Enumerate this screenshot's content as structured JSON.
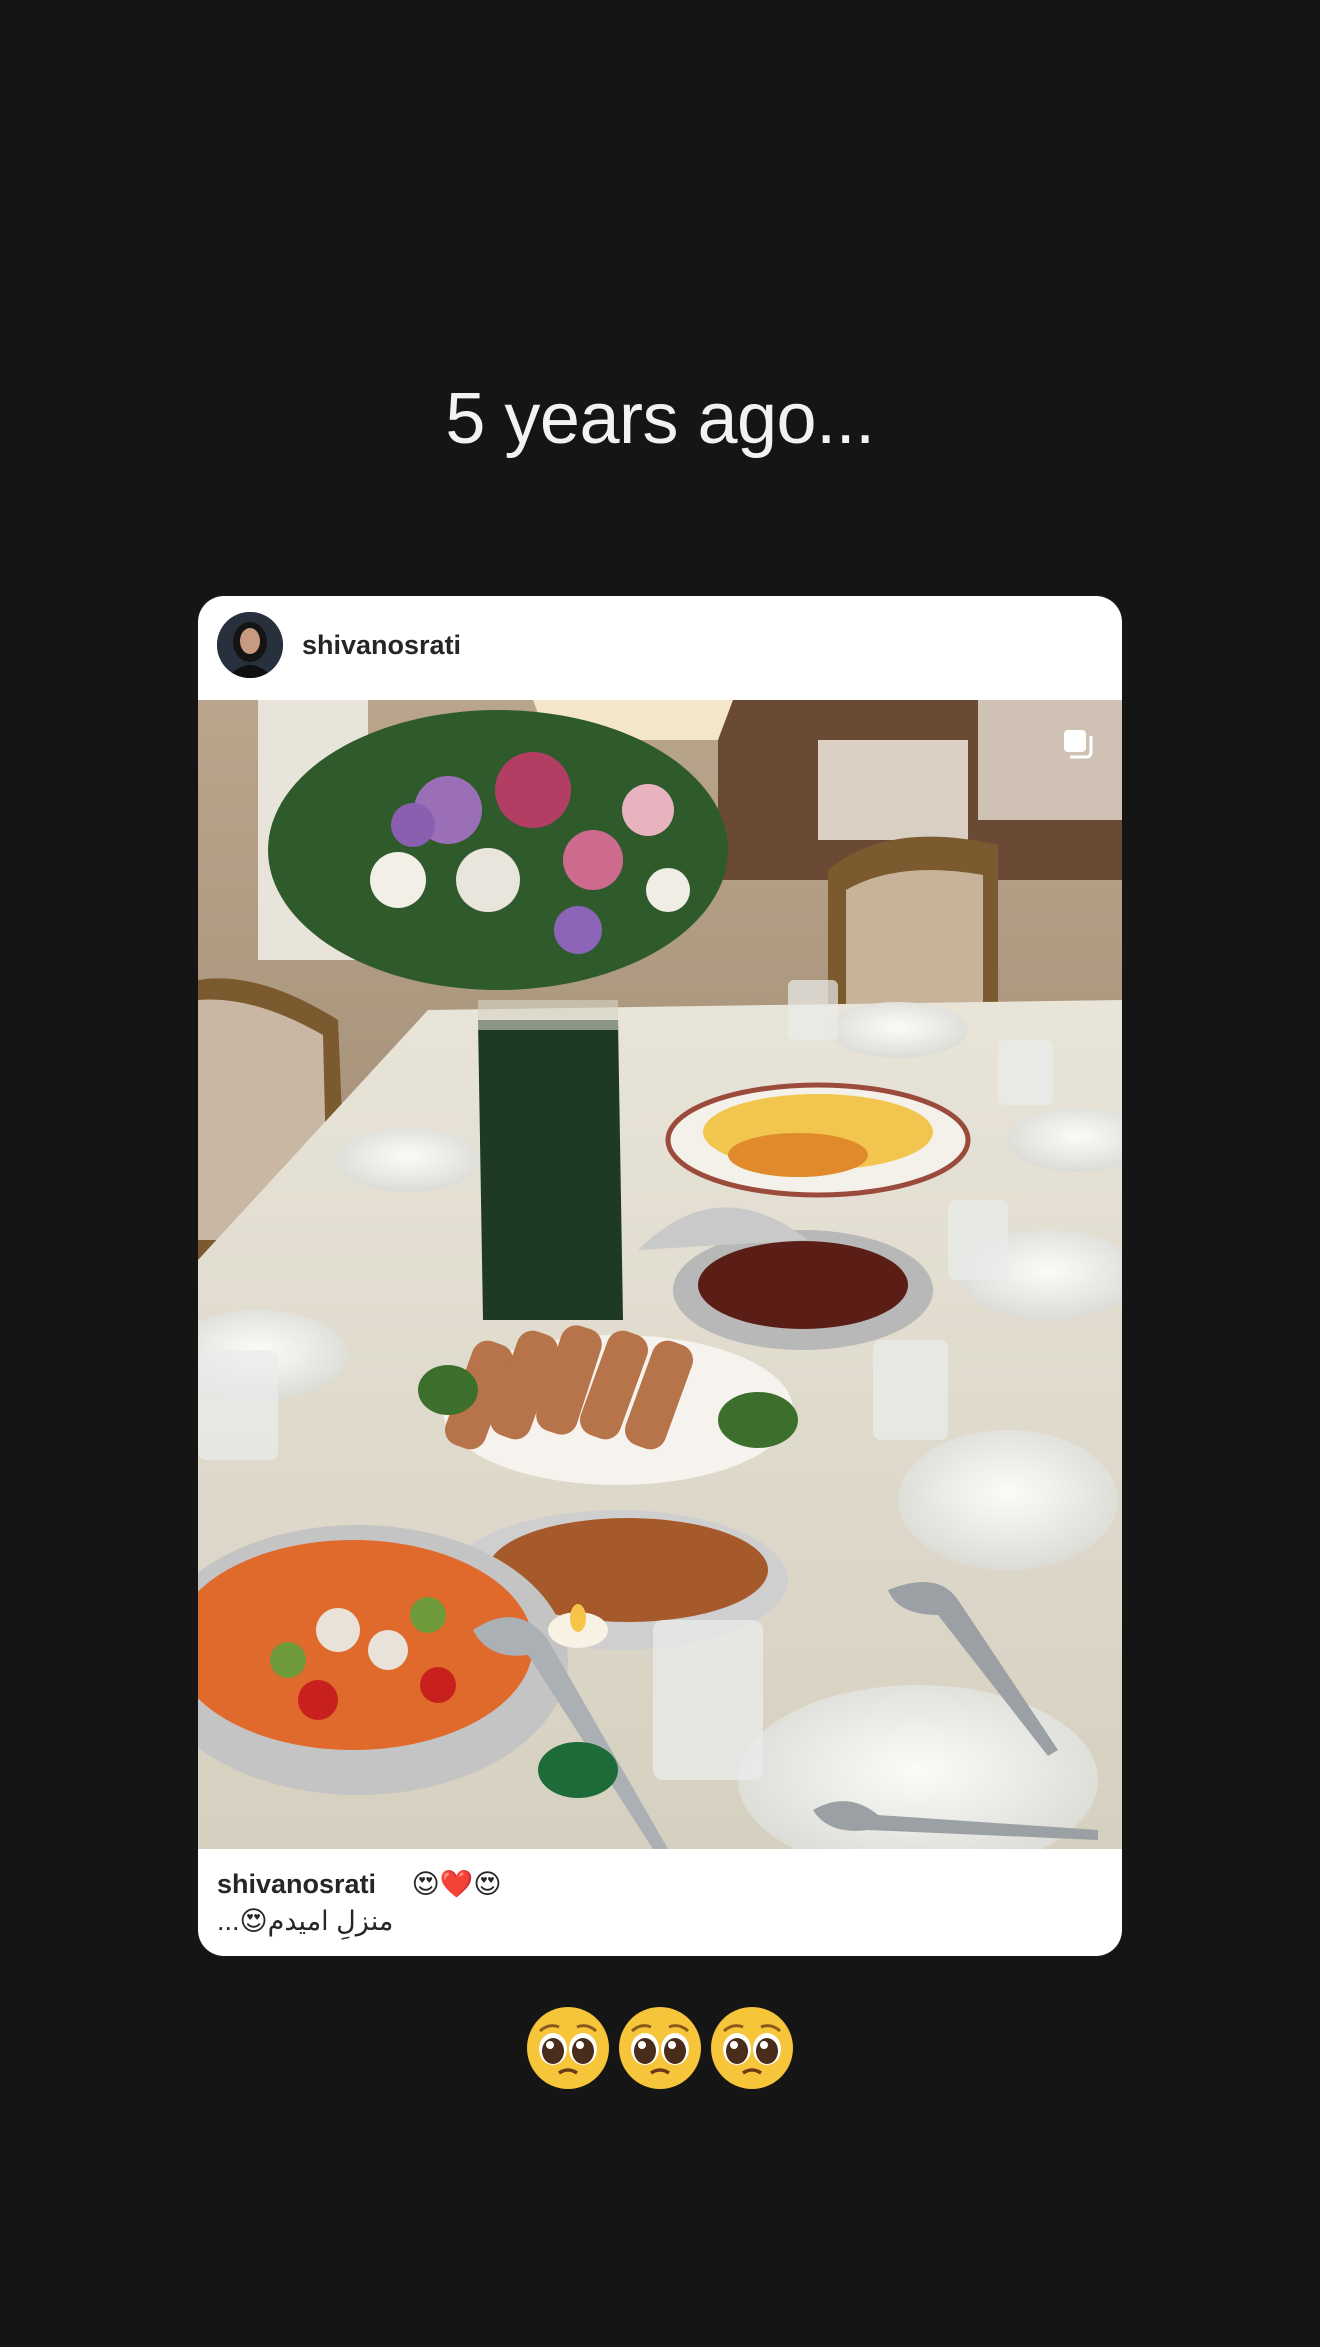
{
  "story": {
    "headline": "5 years ago..."
  },
  "post": {
    "username": "shivanosrati",
    "multi_photo_icon": "multiple-photos-icon",
    "caption": {
      "username": "shivanosrati",
      "emojis": "😍❤️😍",
      "text": "منزلِ امیدم",
      "trailing_emoji": "😍",
      "more": "..."
    }
  },
  "reactions": {
    "icon": "pleading-face-emoji",
    "count": 3
  },
  "colors": {
    "background": "#151515",
    "card": "#ffffff",
    "headline": "#f2f2f2"
  }
}
